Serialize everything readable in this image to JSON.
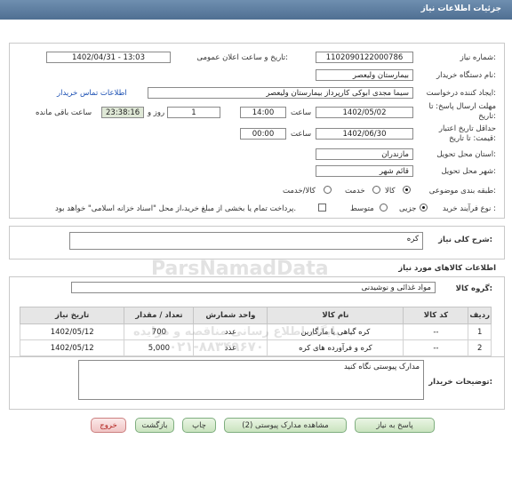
{
  "header": {
    "title": "جزئیات اطلاعات نیاز"
  },
  "form": {
    "need_number_label": "شماره نیاز:",
    "need_number": "1102090122000786",
    "announce_label": "تاریخ و ساعت اعلان عمومی:",
    "announce_value": "1402/04/31 - 13:03",
    "buyer_org_label": "نام دستگاه خریدار:",
    "buyer_org": "بیمارستان ولیعصر",
    "requester_label": "ایجاد کننده درخواست:",
    "requester": "سیما مجدی ابوکی کارپرداز بیمارستان ولیعصر",
    "contact_link": "اطلاعات تماس خریدار",
    "deadline_label": "مهلت ارسال پاسخ: تا تاریخ:",
    "deadline_date": "1402/05/02",
    "time_label": "ساعت",
    "deadline_time": "14:00",
    "days_count": "1",
    "days_label": "روز و",
    "remaining_time": "23:38:16",
    "remaining_label": "ساعت باقی مانده",
    "validity_label": "حداقل تاریخ اعتبار قیمت: تا تاریخ:",
    "validity_date": "1402/06/30",
    "validity_time": "00:00",
    "province_label": "استان محل تحویل:",
    "province": "مازندران",
    "city_label": "شهر محل تحویل:",
    "city": "قائم شهر",
    "category_label": "طبقه بندی موضوعی:",
    "category_options": [
      "کالا",
      "خدمت",
      "کالا/خدمت"
    ],
    "purchase_type_label": "نوع فرآیند خرید :",
    "purchase_type_options": [
      "جزیی",
      "متوسط"
    ],
    "payment_note": "پرداخت تمام یا بخشی از مبلغ خرید،از محل \"اسناد خزانه اسلامی\" خواهد بود."
  },
  "summary": {
    "label": "شرح کلی نیاز:",
    "value": "کره"
  },
  "goods": {
    "section_title": "اطلاعات کالاهای مورد نیاز",
    "group_label": "گروه کالا:",
    "group_value": "مواد غذائی و نوشیدنی",
    "columns": [
      "ردیف",
      "کد کالا",
      "نام کالا",
      "واحد شمارش",
      "تعداد / مقدار",
      "تاریخ نیاز"
    ],
    "rows": [
      [
        "1",
        "--",
        "کره گیاهی یا مارگارین",
        "عدد",
        "700",
        "1402/05/12"
      ],
      [
        "2",
        "--",
        "کره و فرآورده های کره",
        "عدد",
        "5,000",
        "1402/05/12"
      ]
    ]
  },
  "buyer_notes": {
    "label": "توضیحات خریدار:",
    "value": "مدارک پیوستی نگاه کنید"
  },
  "buttons": {
    "reply": "پاسخ به نیاز",
    "attachments": "مشاهده مدارک پیوستی (2)",
    "print": "چاپ",
    "back": "بازگشت",
    "exit": "خروج"
  },
  "watermark": {
    "brand": "ParsNamadData",
    "line1": "پایگاه اطلاع رسانی مناقصه و مزایده",
    "phone": "۰۲۱-۸۸۳۴۹۶۷۰"
  }
}
